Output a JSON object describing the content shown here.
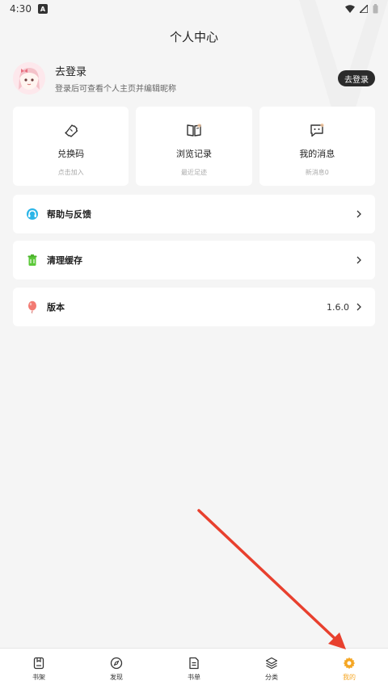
{
  "status_bar": {
    "time": "4:30",
    "notif": "A"
  },
  "header": {
    "title": "个人中心"
  },
  "profile": {
    "name": "去登录",
    "subtitle": "登录后可查看个人主页并编辑昵称",
    "login_button": "去登录"
  },
  "cards": [
    {
      "title": "兑换码",
      "sub": "点击加入",
      "icon": "ticket-icon"
    },
    {
      "title": "浏览记录",
      "sub": "最近足迹",
      "icon": "book-icon"
    },
    {
      "title": "我的消息",
      "sub": "新消息0",
      "icon": "message-icon"
    }
  ],
  "rows": [
    {
      "label": "帮助与反馈",
      "value": "",
      "icon": "headset-icon"
    },
    {
      "label": "清理缓存",
      "value": "",
      "icon": "trash-icon"
    },
    {
      "label": "版本",
      "value": "1.6.0",
      "icon": "balloon-icon"
    }
  ],
  "bottom_nav": [
    {
      "label": "书架",
      "icon": "bookshelf-icon",
      "active": false
    },
    {
      "label": "发现",
      "icon": "compass-icon",
      "active": false
    },
    {
      "label": "书单",
      "icon": "document-icon",
      "active": false
    },
    {
      "label": "分类",
      "icon": "layers-icon",
      "active": false
    },
    {
      "label": "我的",
      "icon": "gear-icon",
      "active": true
    }
  ],
  "colors": {
    "accent": "#f5a623",
    "annotation_arrow": "#e8402e",
    "background": "#f5f5f5"
  }
}
